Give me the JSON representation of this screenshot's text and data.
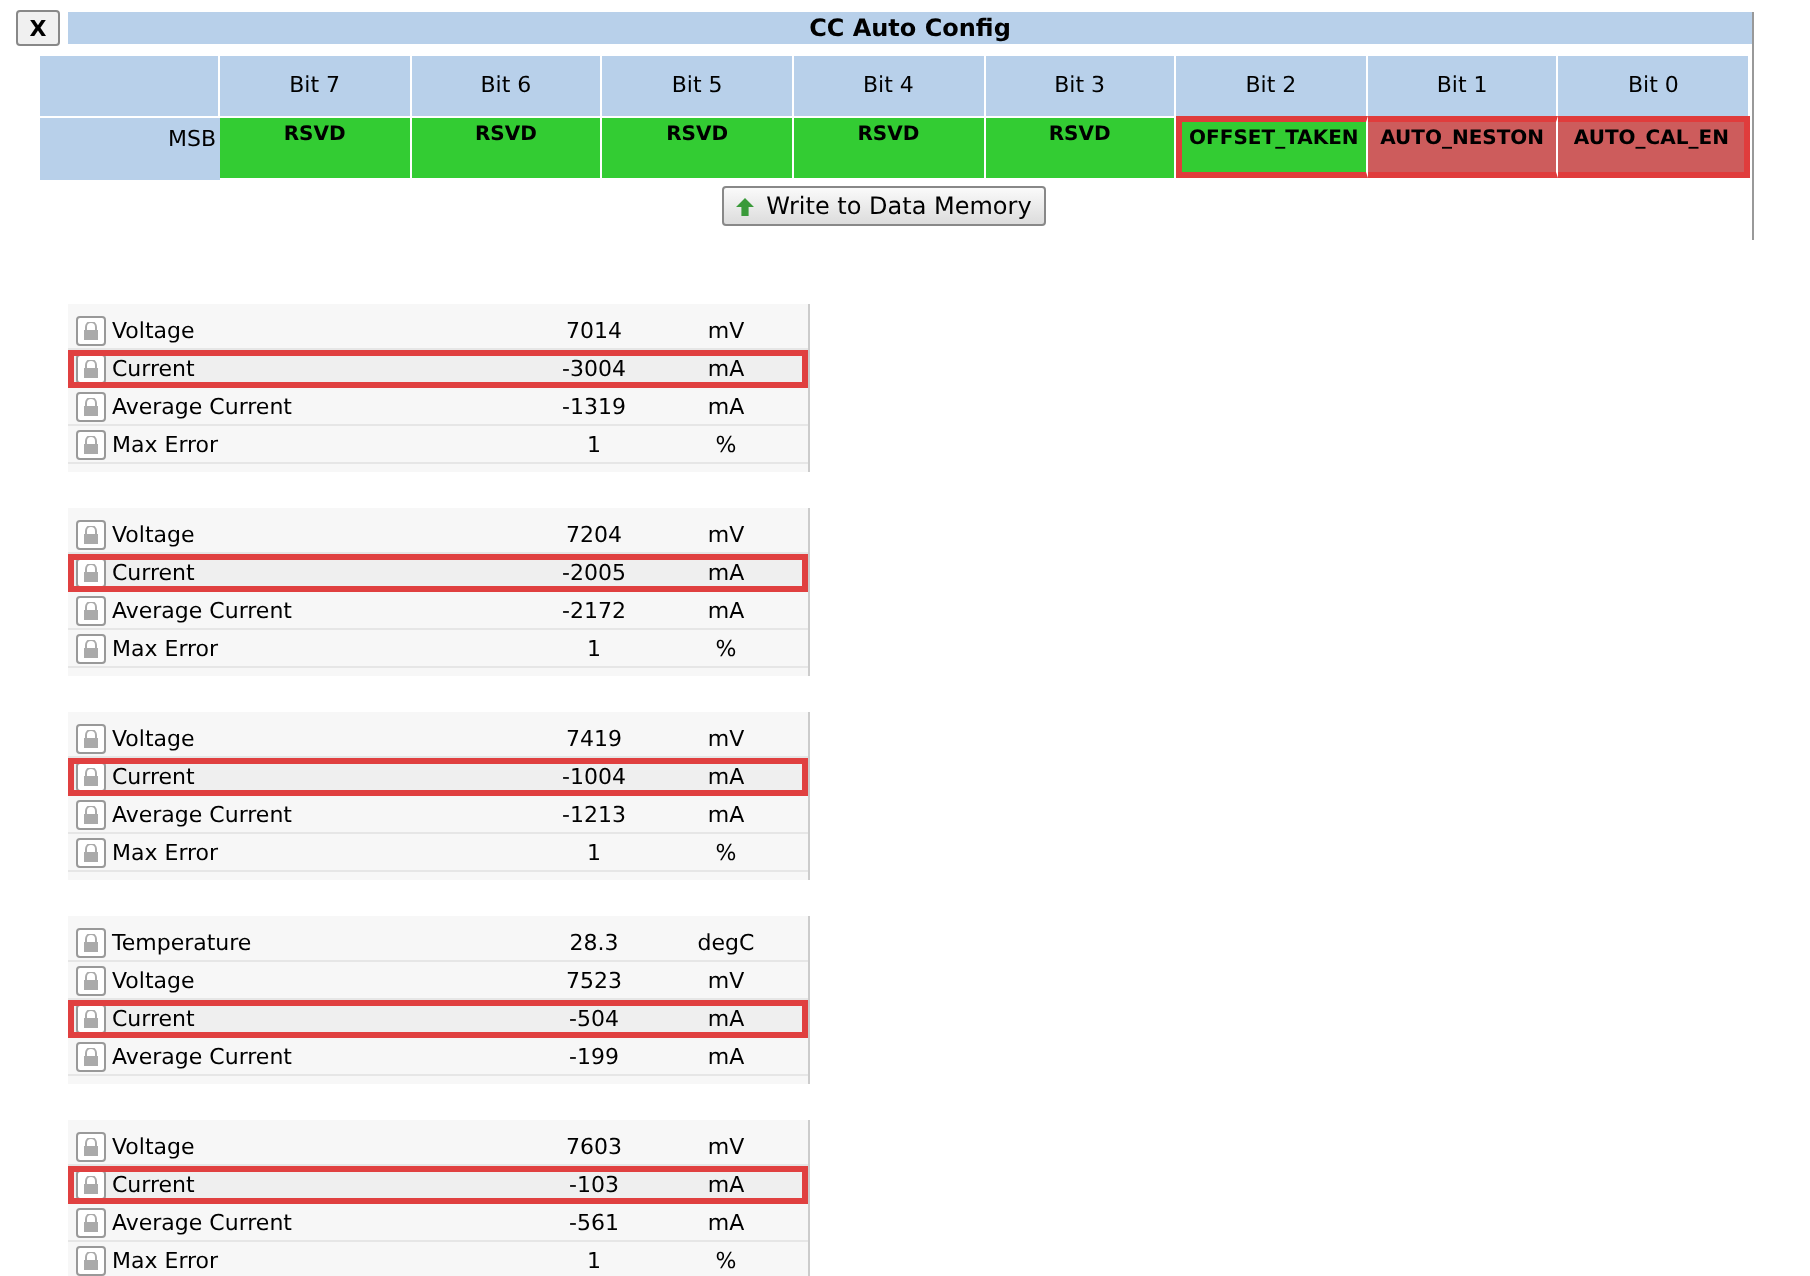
{
  "config": {
    "close_label": "X",
    "title": "CC Auto Config",
    "row_label": "MSB",
    "bits": [
      {
        "header": "Bit 7",
        "name": "RSVD",
        "color": "#33cc33",
        "highlighted": false
      },
      {
        "header": "Bit 6",
        "name": "RSVD",
        "color": "#33cc33",
        "highlighted": false
      },
      {
        "header": "Bit 5",
        "name": "RSVD",
        "color": "#33cc33",
        "highlighted": false
      },
      {
        "header": "Bit 4",
        "name": "RSVD",
        "color": "#33cc33",
        "highlighted": false
      },
      {
        "header": "Bit 3",
        "name": "RSVD",
        "color": "#33cc33",
        "highlighted": false
      },
      {
        "header": "Bit 2",
        "name": "OFFSET_TAKEN",
        "color": "#33cc33",
        "highlighted": true
      },
      {
        "header": "Bit 1",
        "name": "AUTO_NESTON",
        "color": "#cd5c5c",
        "highlighted": true
      },
      {
        "header": "Bit 0",
        "name": "AUTO_CAL_EN",
        "color": "#cd5c5c",
        "highlighted": true
      }
    ],
    "write_button": "Write to Data Memory"
  },
  "panels": [
    {
      "rows": [
        {
          "name": "Voltage",
          "value": "7014",
          "unit": "mV",
          "highlighted": false
        },
        {
          "name": "Current",
          "value": "-3004",
          "unit": "mA",
          "highlighted": true
        },
        {
          "name": "Average Current",
          "value": "-1319",
          "unit": "mA",
          "highlighted": false
        },
        {
          "name": "Max Error",
          "value": "1",
          "unit": "%",
          "highlighted": false
        }
      ]
    },
    {
      "rows": [
        {
          "name": "Voltage",
          "value": "7204",
          "unit": "mV",
          "highlighted": false
        },
        {
          "name": "Current",
          "value": "-2005",
          "unit": "mA",
          "highlighted": true
        },
        {
          "name": "Average Current",
          "value": "-2172",
          "unit": "mA",
          "highlighted": false
        },
        {
          "name": "Max Error",
          "value": "1",
          "unit": "%",
          "highlighted": false
        }
      ]
    },
    {
      "rows": [
        {
          "name": "Voltage",
          "value": "7419",
          "unit": "mV",
          "highlighted": false
        },
        {
          "name": "Current",
          "value": "-1004",
          "unit": "mA",
          "highlighted": true
        },
        {
          "name": "Average Current",
          "value": "-1213",
          "unit": "mA",
          "highlighted": false
        },
        {
          "name": "Max Error",
          "value": "1",
          "unit": "%",
          "highlighted": false
        }
      ]
    },
    {
      "rows": [
        {
          "name": "Temperature",
          "value": "28.3",
          "unit": "degC",
          "highlighted": false
        },
        {
          "name": "Voltage",
          "value": "7523",
          "unit": "mV",
          "highlighted": false
        },
        {
          "name": "Current",
          "value": "-504",
          "unit": "mA",
          "highlighted": true
        },
        {
          "name": "Average Current",
          "value": "-199",
          "unit": "mA",
          "highlighted": false
        }
      ]
    },
    {
      "rows": [
        {
          "name": "Voltage",
          "value": "7603",
          "unit": "mV",
          "highlighted": false
        },
        {
          "name": "Current",
          "value": "-103",
          "unit": "mA",
          "highlighted": true
        },
        {
          "name": "Average Current",
          "value": "-561",
          "unit": "mA",
          "highlighted": false
        },
        {
          "name": "Max Error",
          "value": "1",
          "unit": "%",
          "highlighted": false
        }
      ]
    }
  ]
}
